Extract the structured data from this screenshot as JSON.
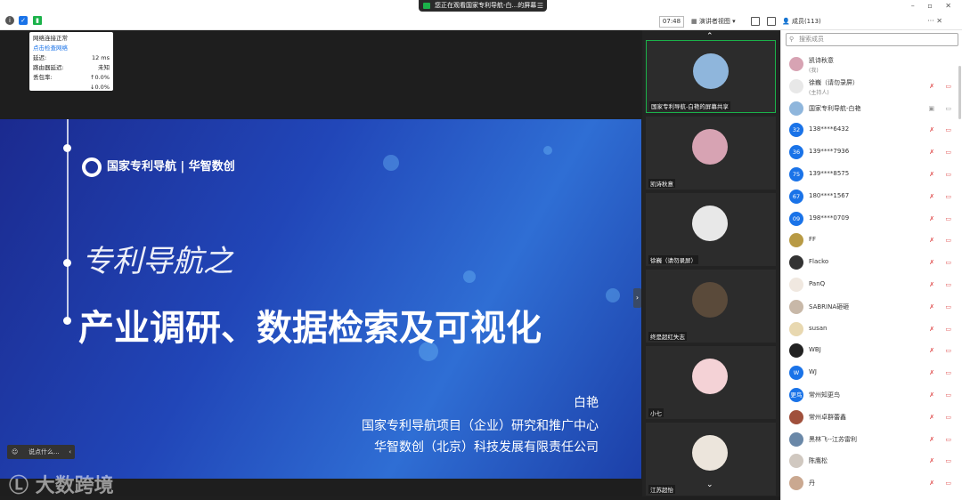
{
  "toolbar": {
    "share_banner": "您正在观看国家专利导航-白...的屏幕",
    "time": "07:48",
    "view_mode": "演讲者视图",
    "members_title": "成员(113)"
  },
  "network": {
    "status": "网络连接正常",
    "check_link": "点击检查网络",
    "rows": [
      {
        "label": "延迟:",
        "value": "12 ms"
      },
      {
        "label": "路由器延迟:",
        "value": "未知"
      },
      {
        "label": "丢包率:",
        "value": "↑0.0%"
      },
      {
        "label": "",
        "value": "↓0.0%"
      }
    ]
  },
  "slide": {
    "logo": "国家专利导航 | 华智数创",
    "title_italic": "专利导航之",
    "title_main": "产业调研、数据检索及可视化",
    "author": "白艳",
    "org1": "国家专利导航项目（企业）研究和推广中心",
    "org2": "华智数创（北京）科技发展有限责任公司"
  },
  "chat_placeholder": "说点什么...",
  "watermark": "大数跨境",
  "tiles": [
    {
      "label": "国家专利导航-白艳的屏幕共享",
      "color": "#8fb6dc"
    },
    {
      "label": "凯诗秋意",
      "color": "#d7a3b3"
    },
    {
      "label": "徐巍（请勿录屏）",
      "color": "#e8e8e8"
    },
    {
      "label": "终是超红失志",
      "color": "#5a4a3a"
    },
    {
      "label": "小七",
      "color": "#f4d2d6"
    },
    {
      "label": "江苏超怡",
      "color": "#ece5dc"
    }
  ],
  "members": {
    "search_placeholder": "搜索成员",
    "list": [
      {
        "name": "凯诗秋意",
        "sub": "(我)",
        "av": "",
        "color": "#d7a3b3"
      },
      {
        "name": "徐巍（请勿录屏）",
        "sub": "(主持人)",
        "av": "",
        "color": "#e8e8e8"
      },
      {
        "name": "国家专利导航-白艳",
        "sub": "",
        "av": "",
        "color": "#8fb6dc"
      },
      {
        "name": "138****6432",
        "sub": "",
        "av": "32",
        "color": "#1a73e8"
      },
      {
        "name": "139****7936",
        "sub": "",
        "av": "36",
        "color": "#1a73e8"
      },
      {
        "name": "139****8575",
        "sub": "",
        "av": "75",
        "color": "#1a73e8"
      },
      {
        "name": "180****1567",
        "sub": "",
        "av": "67",
        "color": "#1a73e8"
      },
      {
        "name": "198****0709",
        "sub": "",
        "av": "09",
        "color": "#1a73e8"
      },
      {
        "name": "FF",
        "sub": "",
        "av": "",
        "color": "#b89a44"
      },
      {
        "name": "Flacko",
        "sub": "",
        "av": "",
        "color": "#333333"
      },
      {
        "name": "PanQ",
        "sub": "",
        "av": "",
        "color": "#f0e8e0"
      },
      {
        "name": "SABRINA砸砸",
        "sub": "",
        "av": "",
        "color": "#c8b8a8"
      },
      {
        "name": "susan",
        "sub": "",
        "av": "",
        "color": "#e8d8b0"
      },
      {
        "name": "WBJ",
        "sub": "",
        "av": "",
        "color": "#222222"
      },
      {
        "name": "WJ",
        "sub": "",
        "av": "W",
        "color": "#1a73e8"
      },
      {
        "name": "常州知更鸟",
        "sub": "",
        "av": "更鸟",
        "color": "#1a73e8"
      },
      {
        "name": "常州卓群蕾鑫",
        "sub": "",
        "av": "",
        "color": "#a0503c"
      },
      {
        "name": "黑林飞--江苏雷利",
        "sub": "",
        "av": "",
        "color": "#6a88a8"
      },
      {
        "name": "陈鹰松",
        "sub": "",
        "av": "",
        "color": "#d0c8c0"
      },
      {
        "name": "丹",
        "sub": "",
        "av": "",
        "color": "#caa890"
      }
    ]
  }
}
